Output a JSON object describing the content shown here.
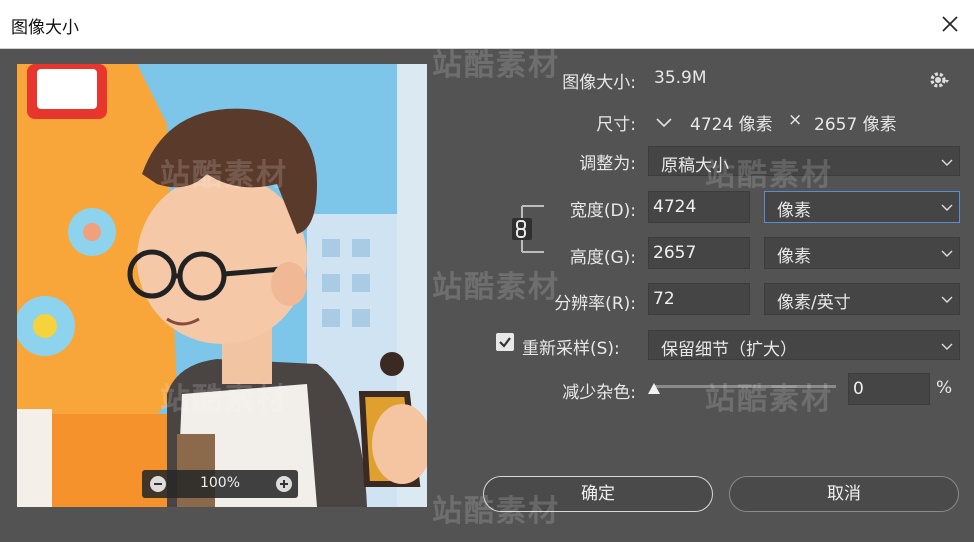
{
  "window": {
    "title": "图像大小"
  },
  "info": {
    "image_size_label": "图像大小:",
    "image_size_value": "35.9M",
    "dimensions_label": "尺寸:",
    "dim_width": "4724 像素",
    "dim_times": "×",
    "dim_height": "2657 像素"
  },
  "fit_to": {
    "label": "调整为:",
    "value": "原稿大小"
  },
  "width": {
    "label": "宽度(D):",
    "value": "4724",
    "unit": "像素"
  },
  "height": {
    "label": "高度(G):",
    "value": "2657",
    "unit": "像素"
  },
  "resolution": {
    "label": "分辨率(R):",
    "value": "72",
    "unit": "像素/英寸"
  },
  "resample": {
    "label": "重新采样(S):",
    "checked": true,
    "value": "保留细节（扩大）"
  },
  "noise": {
    "label": "减少杂色:",
    "value": "0",
    "unit": "%",
    "slider_level": 0
  },
  "preview": {
    "zoom": "100%"
  },
  "buttons": {
    "ok": "确定",
    "cancel": "取消"
  },
  "watermark": "站酷素材",
  "colors": {
    "panel": "#535353",
    "field": "#454545",
    "focus": "#5a8dd6"
  }
}
